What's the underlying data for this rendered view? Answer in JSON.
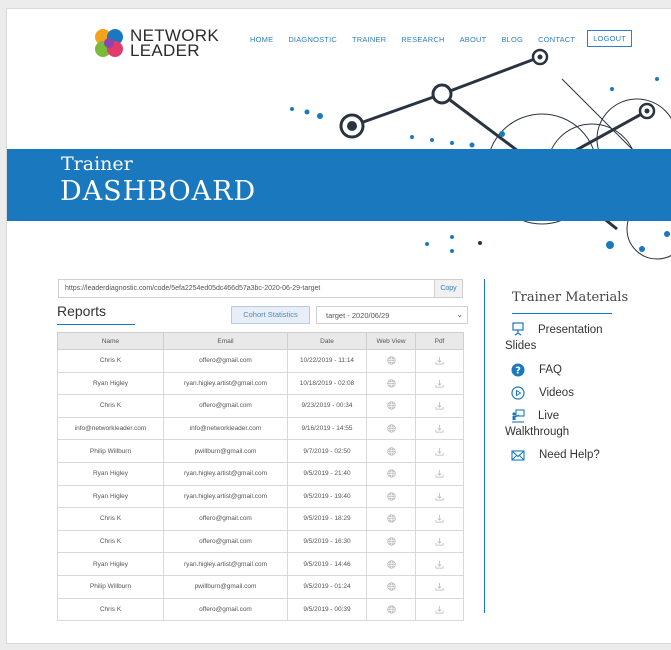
{
  "header": {
    "logo_line1": "NETWORK",
    "logo_line2": "LEADER",
    "nav": [
      "HOME",
      "DIAGNOSTIC",
      "TRAINER",
      "RESEARCH",
      "ABOUT",
      "BLOG",
      "CONTACT"
    ],
    "logout_label": "LOGOUT"
  },
  "banner": {
    "title_small": "Trainer",
    "title_large": "DASHBOARD"
  },
  "code_bar": {
    "url": "https://leaderdiagnostic.com/code/5efa2254ed05dc466d57a3bc-2020-06-29-target",
    "copy_label": "Copy"
  },
  "reports": {
    "heading": "Reports",
    "cohort_button": "Cohort Statistics",
    "target_selected": "target - 2020/06/29",
    "columns": [
      "Name",
      "Email",
      "Date",
      "Web View",
      "Pdf"
    ],
    "rows": [
      {
        "name": "Chris K",
        "email": "offero@gmail.com",
        "date": "10/22/2019 - 11:14"
      },
      {
        "name": "Ryan Higley",
        "email": "ryan.higley.artist@gmail.com",
        "date": "10/18/2019 - 02:08"
      },
      {
        "name": "Chris K",
        "email": "offero@gmail.com",
        "date": "9/23/2019 - 00:34"
      },
      {
        "name": "info@networkleader.com",
        "email": "info@networkleader.com",
        "date": "9/16/2019 - 14:55"
      },
      {
        "name": "Philip Willburn",
        "email": "pwillburn@gmail.com",
        "date": "9/7/2019 - 02:50"
      },
      {
        "name": "Ryan Higley",
        "email": "ryan.higley.artist@gmail.com",
        "date": "9/5/2019 - 21:40"
      },
      {
        "name": "Ryan Higley",
        "email": "ryan.higley.artist@gmail.com",
        "date": "9/5/2019 - 19:40"
      },
      {
        "name": "Chris K",
        "email": "offero@gmail.com",
        "date": "9/5/2019 - 18:29"
      },
      {
        "name": "Chris K",
        "email": "offero@gmail.com",
        "date": "9/5/2019 - 16:30"
      },
      {
        "name": "Ryan Higley",
        "email": "ryan.higley.artist@gmail.com",
        "date": "9/5/2019 - 14:46"
      },
      {
        "name": "Philip Willburn",
        "email": "pwillburn@gmail.com",
        "date": "9/5/2019 - 01:24"
      },
      {
        "name": "Chris K",
        "email": "offero@gmail.com",
        "date": "9/5/2019 - 00:39"
      }
    ],
    "web_view_icon": "globe-icon",
    "pdf_icon": "download-icon"
  },
  "materials": {
    "title": "Trainer Materials",
    "items": [
      {
        "label": "Presentation Slides",
        "icon": "presentation-icon"
      },
      {
        "label": "FAQ",
        "icon": "question-icon"
      },
      {
        "label": "Videos",
        "icon": "play-icon"
      },
      {
        "label": "Live Walkthrough",
        "icon": "presenter-icon"
      },
      {
        "label": "Need Help?",
        "icon": "mail-icon"
      }
    ]
  },
  "colors": {
    "brand_blue": "#1a79be",
    "link_blue": "#2f7fc1"
  }
}
